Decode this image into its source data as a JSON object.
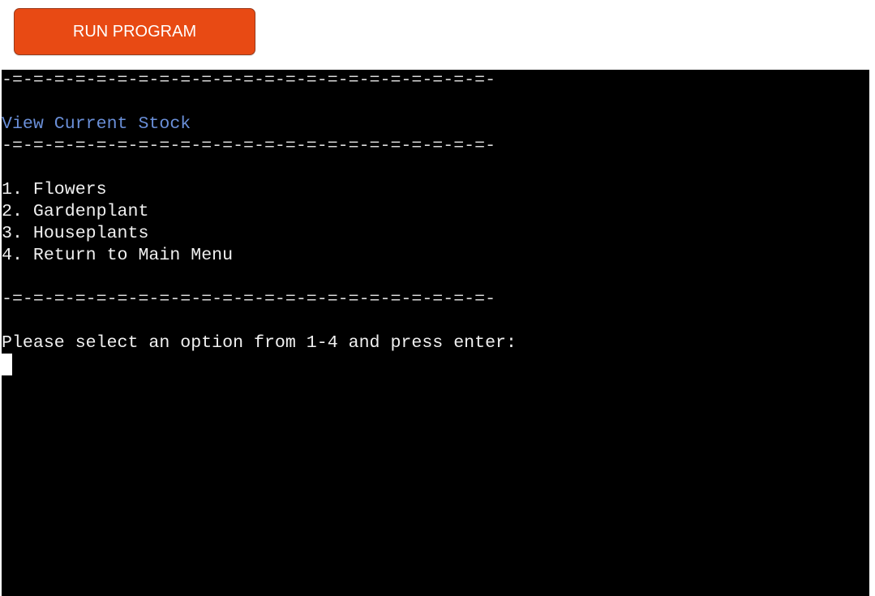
{
  "run_button": {
    "label": "RUN PROGRAM"
  },
  "colors": {
    "button_bg": "#e84a14",
    "terminal_bg": "#000000",
    "terminal_text": "#f0f0f0",
    "heading_text": "#6a8fd8"
  },
  "terminal": {
    "divider": "-=-=-=-=-=-=-=-=-=-=-=-=-=-=-=-=-=-=-=-=-=-=-=-",
    "heading": "View Current Stock",
    "menu": [
      "1. Flowers",
      "2. Gardenplant",
      "3. Houseplants",
      "4. Return to Main Menu"
    ],
    "prompt": "Please select an option from 1-4 and press enter:"
  }
}
